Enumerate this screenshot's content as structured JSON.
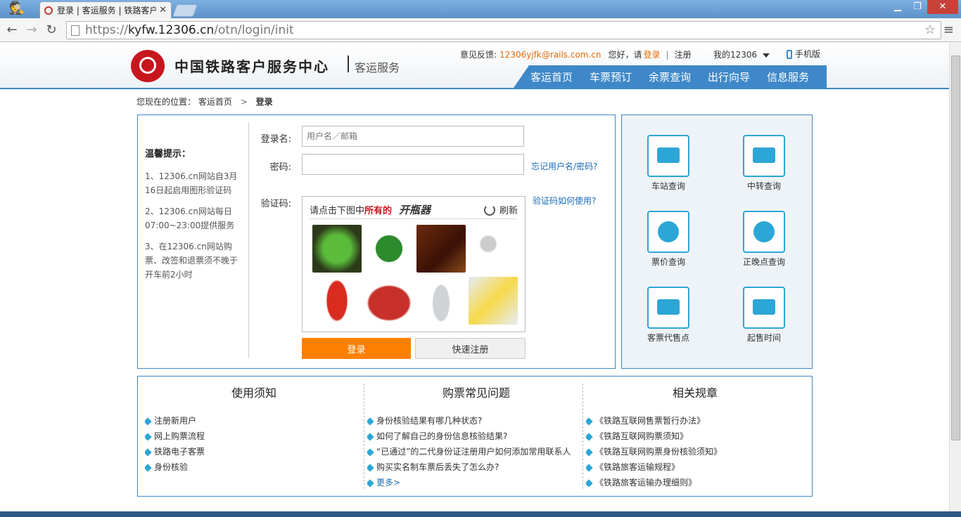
{
  "browser": {
    "tab_title": "登录 | 客运服务 | 铁路客户服务中心",
    "url_scheme": "https://",
    "url_host": "kyfw.12306.cn",
    "url_path": "/otn/login/init"
  },
  "header": {
    "logo_text": "中国铁路客户服务中心",
    "logo_sub": "客运服务",
    "feedback_label": "意见反馈:",
    "feedback_email": "12306yjfk@rails.com.cn",
    "greeting": "您好，请",
    "login_link": "登录",
    "register_link": "注册",
    "my12306": "我的12306",
    "mobile": "手机版",
    "nav": [
      "客运首页",
      "车票预订",
      "余票查询",
      "出行向导",
      "信息服务"
    ]
  },
  "breadcrumb": {
    "prefix": "您现在的位置：",
    "home": "客运首页",
    "sep": ">",
    "current": "登录"
  },
  "login": {
    "tips_title": "温馨提示：",
    "tips": [
      "1、12306.cn网站自3月16日起启用图形验证码",
      "2、12306.cn网站每日07:00~23:00提供服务",
      "3、在12306.cn网站购票、改签和退票须不晚于开车前2小时"
    ],
    "username_label": "登录名:",
    "username_placeholder": "用户名／邮箱",
    "password_label": "密码:",
    "forgot_link": "忘记用户名/密码?",
    "captcha_label": "验证码:",
    "captcha_help": "验证码如何使用?",
    "captcha_prompt_a": "请点击下图中",
    "captcha_prompt_b": "所有的",
    "captcha_word": "开瓶器",
    "refresh_label": "刷新",
    "login_button": "登录",
    "quick_register_button": "快速注册"
  },
  "services": [
    "车站查询",
    "中转查询",
    "票价查询",
    "正晚点查询",
    "客票代售点",
    "起售时间"
  ],
  "info": {
    "col1_title": "使用须知",
    "col1_items": [
      "注册新用户",
      "网上购票流程",
      "铁路电子客票",
      "身份核验"
    ],
    "col2_title": "购票常见问题",
    "col2_items": [
      "身份核验结果有哪几种状态?",
      "如何了解自己的身份信息核验结果?",
      "“已通过”的二代身份证注册用户如何添加常用联系人",
      "购买实名制车票后丢失了怎么办?"
    ],
    "col2_more": "更多>",
    "col3_title": "相关规章",
    "col3_items": [
      "《铁路互联网售票暂行办法》",
      "《铁路互联网购票须知》",
      "《铁路互联网购票身份核验须知》",
      "《铁路旅客运输规程》",
      "《铁路旅客运输办理细则》"
    ]
  },
  "colors": {
    "brand_blue": "#3e88c9",
    "accent_orange": "#ff8000",
    "logo_red": "#c8161d"
  }
}
